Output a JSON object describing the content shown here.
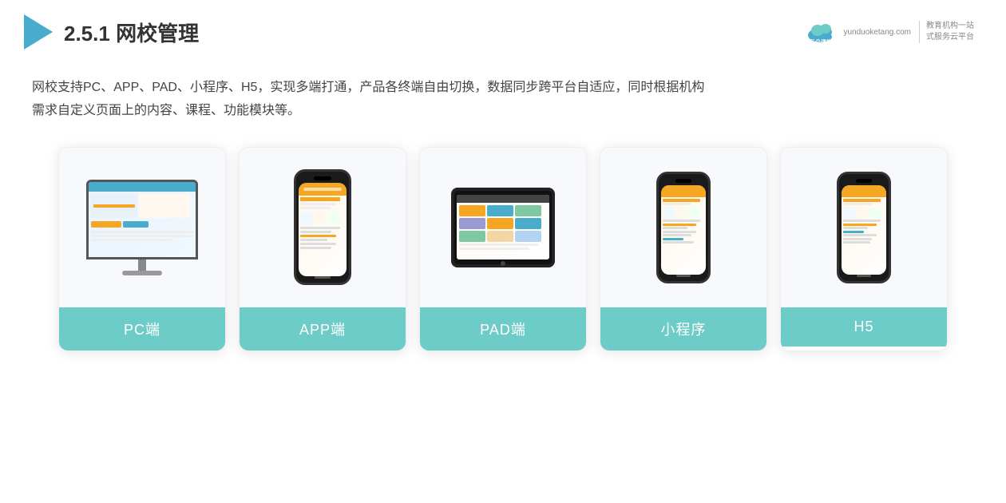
{
  "header": {
    "title_prefix": "2.5.1 ",
    "title_main": "网校管理",
    "brand_name": "云朵课堂",
    "brand_domain": "yunduoketang.com",
    "brand_tagline_line1": "教育机构一站",
    "brand_tagline_line2": "式服务云平台"
  },
  "description": {
    "text_line1": "网校支持PC、APP、PAD、小程序、H5，实现多端打通，产品各终端自由切换，数据同步跨平台自适应，同时根据机构",
    "text_line2": "需求自定义页面上的内容、课程、功能模块等。"
  },
  "cards": [
    {
      "id": "pc",
      "label": "PC端"
    },
    {
      "id": "app",
      "label": "APP端"
    },
    {
      "id": "pad",
      "label": "PAD端"
    },
    {
      "id": "miniprogram",
      "label": "小程序"
    },
    {
      "id": "h5",
      "label": "H5"
    }
  ],
  "colors": {
    "accent": "#6ECCC8",
    "accent2": "#4AACCC",
    "brand_color": "#4AACCC",
    "orange": "#f5a623"
  }
}
